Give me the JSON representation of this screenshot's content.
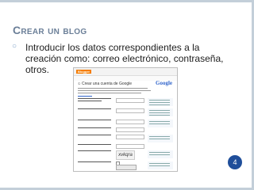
{
  "slide": {
    "title": "Crear un blog",
    "bullet": "Introducir los datos correspondientes a la creación como: correo electrónico, contraseña, otros.",
    "page_number": "4"
  },
  "screenshot": {
    "brand": "Blogger",
    "heading": "Crear una cuenta de Google",
    "google": "Google",
    "captcha_word": "xvkqra"
  },
  "colors": {
    "title": "#6b7f98",
    "bullet": "#7ea1c7",
    "badge": "#1f4e9a",
    "frame": "#c3cfd9"
  }
}
